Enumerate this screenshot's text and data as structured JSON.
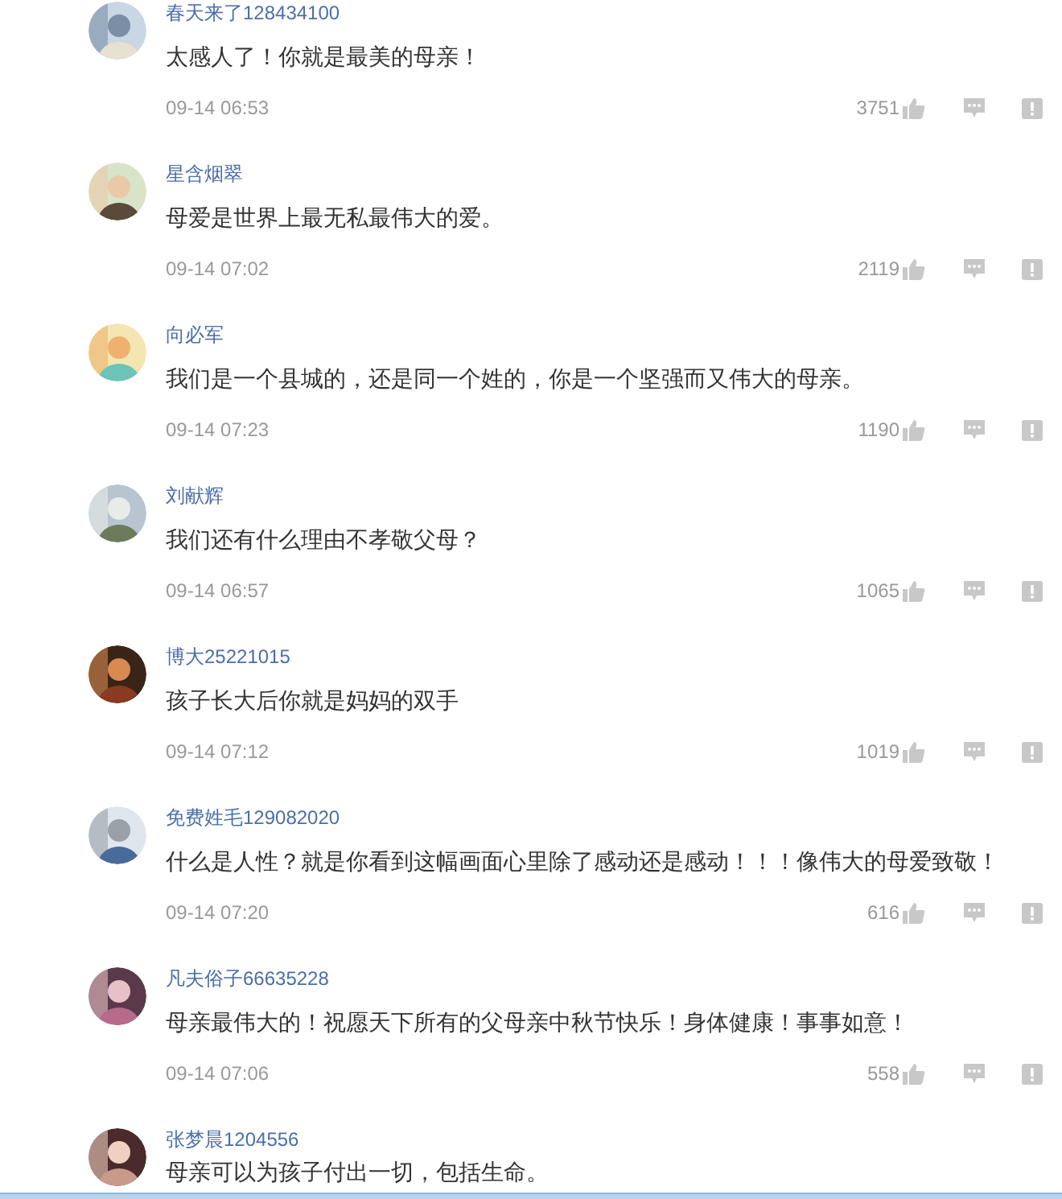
{
  "comments": [
    {
      "user": "春天来了128434100",
      "text": "太感人了！你就是最美的母亲！",
      "time": "09-14 06:53",
      "likes": "3751"
    },
    {
      "user": "星含烟翠",
      "text": "母爱是世界上最无私最伟大的爱。",
      "time": "09-14 07:02",
      "likes": "2119"
    },
    {
      "user": "向必军",
      "text": "我们是一个县城的，还是同一个姓的，你是一个坚强而又伟大的母亲。",
      "time": "09-14 07:23",
      "likes": "1190"
    },
    {
      "user": "刘献辉",
      "text": "我们还有什么理由不孝敬父母？",
      "time": "09-14 06:57",
      "likes": "1065"
    },
    {
      "user": "博大25221015",
      "text": "孩子长大后你就是妈妈的双手",
      "time": "09-14 07:12",
      "likes": "1019"
    },
    {
      "user": "免费姓毛129082020",
      "text": "什么是人性？就是你看到这幅画面心里除了感动还是感动！！！像伟大的母爱致敬！",
      "time": "09-14 07:20",
      "likes": "616"
    },
    {
      "user": "凡夫俗子66635228",
      "text": "母亲最伟大的！祝愿天下所有的父母亲中秋节快乐！身体健康！事事如意！",
      "time": "09-14 07:06",
      "likes": "558"
    },
    {
      "user": "张梦晨1204556",
      "text": "母亲可以为孩子付出一切，包括生命。"
    }
  ]
}
